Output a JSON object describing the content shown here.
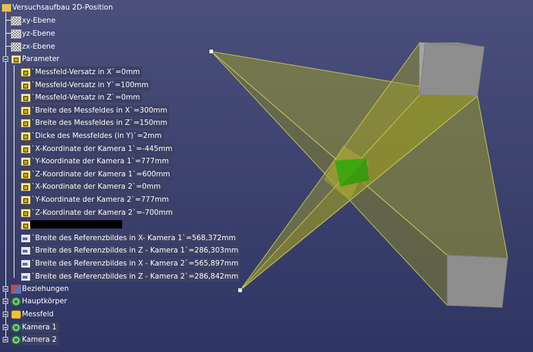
{
  "tree": {
    "root": {
      "label": "Versuchsaufbau 2D-Position",
      "icon": "assembly-icon"
    },
    "planes": [
      {
        "label": "xy-Ebene",
        "icon": "plane-icon"
      },
      {
        "label": "yz-Ebene",
        "icon": "plane-icon"
      },
      {
        "label": "zx-Ebene",
        "icon": "plane-icon"
      }
    ],
    "parameter": {
      "label": "Parameter",
      "icon": "parameter-set-icon"
    },
    "params": [
      {
        "label": "`Messfeld-Versatz in X`=0mm",
        "icon": "parameter-icon"
      },
      {
        "label": "`Messfeld-Versatz in Y`=100mm",
        "icon": "parameter-icon"
      },
      {
        "label": "`Messfeld-Versatz in Z`=0mm",
        "icon": "parameter-icon"
      },
      {
        "label": "`Breite des Messfeldes in X`=300mm",
        "icon": "parameter-icon"
      },
      {
        "label": "`Breite des Messfeldes in Z`=150mm",
        "icon": "parameter-icon"
      },
      {
        "label": "`Dicke des Messfeldes (in Y)`=2mm",
        "icon": "parameter-icon"
      },
      {
        "label": "`X-Koordinate der Kamera 1`=-445mm",
        "icon": "parameter-icon"
      },
      {
        "label": "`Y-Koordinate der Kamera 1`=777mm",
        "icon": "parameter-icon"
      },
      {
        "label": "`Z-Koordinate der Kamera 1`=600mm",
        "icon": "parameter-icon"
      },
      {
        "label": "`X-Koordinate der Kamera 2`=0mm",
        "icon": "parameter-icon"
      },
      {
        "label": "`Y-Koordinate der Kamera 2`=777mm",
        "icon": "parameter-icon"
      },
      {
        "label": "`Z-Koordinate der Kamera 2`=-700mm",
        "icon": "parameter-icon"
      },
      {
        "label": "",
        "icon": "parameter-icon",
        "redacted": true
      }
    ],
    "refs": [
      {
        "label": "`Breite des Referenzbildes in X- Kamera 1`=568,372mm",
        "icon": "formula-icon"
      },
      {
        "label": "`Breite des Referenzbildes in Z - Kamera 1`=286,303mm",
        "icon": "formula-icon"
      },
      {
        "label": "`Breite des Referenzbildes in X - Kamera 2`=565,897mm",
        "icon": "formula-icon"
      },
      {
        "label": "`Breite des Referenzbildes in Z - Kamera 2`=286,842mm",
        "icon": "formula-icon"
      }
    ],
    "bottom": [
      {
        "label": "Beziehungen",
        "icon": "relations-icon"
      },
      {
        "label": "Hauptkörper",
        "icon": "body-icon"
      },
      {
        "label": "Messfeld",
        "icon": "part-icon"
      },
      {
        "label": "Kamera 1",
        "icon": "body-icon"
      },
      {
        "label": "Kamera 2",
        "icon": "body-icon"
      }
    ]
  },
  "colors": {
    "viewport_top": "#4a4f7c",
    "viewport_bottom": "#2f3562",
    "frustum_fill": "#9c9c30",
    "frustum_edge": "#c8c850",
    "camera_box": "#8e8e8e",
    "measurement_field": "#3a9a10",
    "tree_text": "#ffffff"
  }
}
